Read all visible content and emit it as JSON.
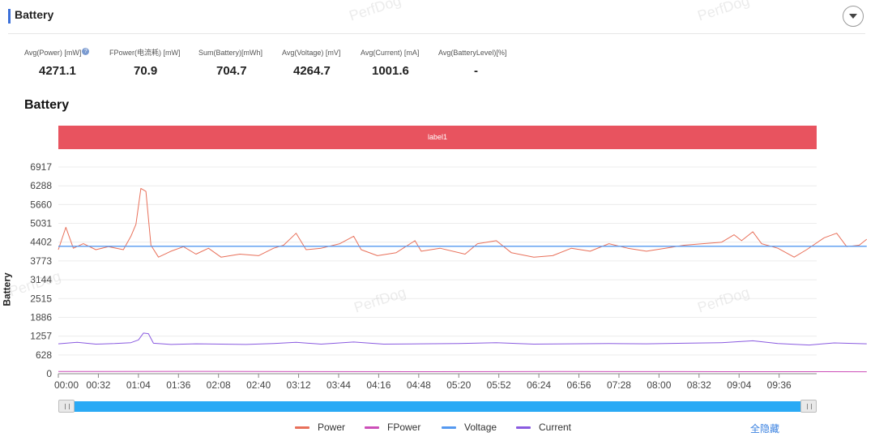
{
  "header": {
    "title": "Battery"
  },
  "stats": [
    {
      "label": "Avg(Power) [mW]",
      "value": "4271.1",
      "help": true
    },
    {
      "label": "FPower(电流耗) [mW]",
      "value": "70.9"
    },
    {
      "label": "Sum(Battery)[mWh]",
      "value": "704.7"
    },
    {
      "label": "Avg(Voltage) [mV]",
      "value": "4264.7"
    },
    {
      "label": "Avg(Current) [mA]",
      "value": "1001.6"
    },
    {
      "label": "Avg(BatteryLevel)[%]",
      "value": "-"
    }
  ],
  "section_title": "Battery",
  "label_band": "label1",
  "hide_all": "全隐藏",
  "watermark": "PerfDog",
  "colors": {
    "power": "#e8705a",
    "fpower": "#cc4fb8",
    "voltage": "#5599f0",
    "current": "#8a5be0",
    "band": "#e8535f",
    "slider": "#2aaaf5"
  },
  "chart_data": {
    "type": "line",
    "title": "",
    "xlabel": "",
    "ylabel": "Battery",
    "ylim": [
      0,
      6917
    ],
    "y_ticks": [
      0,
      628,
      1257,
      1886,
      2515,
      3144,
      3773,
      4402,
      5031,
      5660,
      6288,
      6917
    ],
    "x_ticks": [
      "00:00",
      "00:32",
      "01:04",
      "01:36",
      "02:08",
      "02:40",
      "03:12",
      "03:44",
      "04:16",
      "04:48",
      "05:20",
      "05:52",
      "06:24",
      "06:56",
      "07:28",
      "08:00",
      "08:32",
      "09:04",
      "09:36"
    ],
    "x_range_seconds": [
      0,
      606
    ],
    "grid": "horizontal",
    "legend_position": "bottom",
    "series": [
      {
        "name": "Power",
        "points": [
          [
            0,
            4150
          ],
          [
            6,
            4900
          ],
          [
            12,
            4200
          ],
          [
            20,
            4350
          ],
          [
            30,
            4150
          ],
          [
            40,
            4250
          ],
          [
            52,
            4150
          ],
          [
            58,
            4600
          ],
          [
            62,
            5000
          ],
          [
            66,
            6200
          ],
          [
            70,
            6100
          ],
          [
            74,
            4300
          ],
          [
            80,
            3900
          ],
          [
            90,
            4100
          ],
          [
            100,
            4250
          ],
          [
            110,
            4000
          ],
          [
            120,
            4200
          ],
          [
            130,
            3900
          ],
          [
            145,
            4000
          ],
          [
            160,
            3950
          ],
          [
            172,
            4200
          ],
          [
            180,
            4300
          ],
          [
            190,
            4700
          ],
          [
            198,
            4150
          ],
          [
            210,
            4200
          ],
          [
            225,
            4350
          ],
          [
            236,
            4600
          ],
          [
            242,
            4150
          ],
          [
            255,
            3950
          ],
          [
            270,
            4050
          ],
          [
            285,
            4450
          ],
          [
            290,
            4100
          ],
          [
            305,
            4200
          ],
          [
            325,
            4000
          ],
          [
            335,
            4350
          ],
          [
            350,
            4450
          ],
          [
            362,
            4050
          ],
          [
            380,
            3900
          ],
          [
            395,
            3950
          ],
          [
            410,
            4200
          ],
          [
            425,
            4100
          ],
          [
            440,
            4350
          ],
          [
            455,
            4200
          ],
          [
            470,
            4100
          ],
          [
            485,
            4200
          ],
          [
            500,
            4300
          ],
          [
            515,
            4350
          ],
          [
            530,
            4400
          ],
          [
            540,
            4650
          ],
          [
            546,
            4450
          ],
          [
            555,
            4750
          ],
          [
            562,
            4350
          ],
          [
            575,
            4200
          ],
          [
            588,
            3900
          ],
          [
            598,
            4150
          ],
          [
            612,
            4550
          ],
          [
            622,
            4700
          ],
          [
            630,
            4250
          ],
          [
            640,
            4300
          ],
          [
            646,
            4500
          ]
        ]
      },
      {
        "name": "FPower",
        "points": [
          [
            0,
            72
          ],
          [
            100,
            80
          ],
          [
            200,
            70
          ],
          [
            300,
            68
          ],
          [
            400,
            74
          ],
          [
            500,
            70
          ],
          [
            646,
            66
          ]
        ]
      },
      {
        "name": "Voltage",
        "points": [
          [
            0,
            4264
          ],
          [
            646,
            4264
          ]
        ]
      },
      {
        "name": "Current",
        "points": [
          [
            0,
            1000
          ],
          [
            15,
            1050
          ],
          [
            30,
            990
          ],
          [
            45,
            1010
          ],
          [
            58,
            1040
          ],
          [
            64,
            1130
          ],
          [
            68,
            1360
          ],
          [
            72,
            1340
          ],
          [
            76,
            1020
          ],
          [
            90,
            980
          ],
          [
            110,
            1000
          ],
          [
            130,
            990
          ],
          [
            150,
            980
          ],
          [
            172,
            1010
          ],
          [
            190,
            1050
          ],
          [
            210,
            990
          ],
          [
            236,
            1060
          ],
          [
            260,
            990
          ],
          [
            290,
            1000
          ],
          [
            320,
            1010
          ],
          [
            350,
            1040
          ],
          [
            380,
            990
          ],
          [
            410,
            1000
          ],
          [
            440,
            1010
          ],
          [
            470,
            1000
          ],
          [
            500,
            1020
          ],
          [
            530,
            1040
          ],
          [
            555,
            1100
          ],
          [
            575,
            1010
          ],
          [
            600,
            960
          ],
          [
            620,
            1030
          ],
          [
            646,
            1000
          ]
        ]
      }
    ]
  }
}
